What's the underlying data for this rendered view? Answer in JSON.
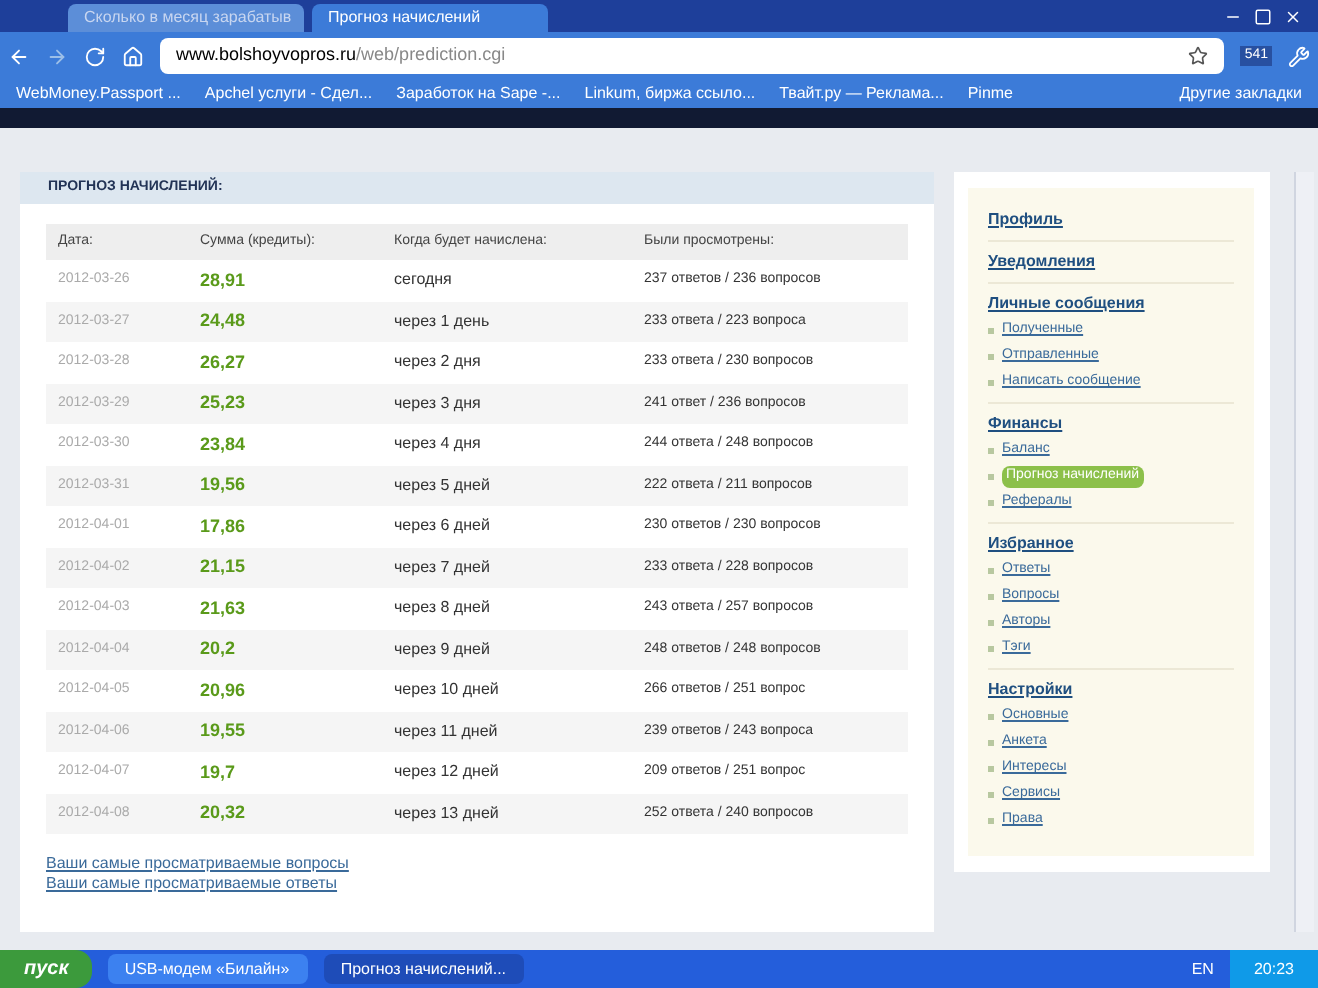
{
  "browser": {
    "tabs": [
      {
        "label": "Сколько в месяц зарабатыв",
        "selected": false
      },
      {
        "label": "Прогноз начислений",
        "selected": true
      }
    ],
    "address": {
      "domain": "www.bolshoyvopros.ru",
      "path": "/web/prediction.cgi"
    },
    "bookmarks": [
      "WebMoney.Passport ...",
      "Apchel услуги - Сдел...",
      "Заработок на Sape -...",
      "Linkum, биржа ссыло...",
      "Твайт.ру — Реклама...",
      "Pinme"
    ],
    "other_bookmarks": "Другие закладки",
    "badge": "541"
  },
  "panel": {
    "title": "ПРОГНОЗ НАЧИСЛЕНИЙ:",
    "columns": [
      "Дата:",
      "Сумма (кредиты):",
      "Когда будет начислена:",
      "Были просмотрены:"
    ],
    "rows": [
      [
        "2012-03-26",
        "28,91",
        "сегодня",
        "237 ответов / 236 вопросов"
      ],
      [
        "2012-03-27",
        "24,48",
        "через 1 день",
        "233 ответа / 223 вопроса"
      ],
      [
        "2012-03-28",
        "26,27",
        "через 2 дня",
        "233 ответа / 230 вопросов"
      ],
      [
        "2012-03-29",
        "25,23",
        "через 3 дня",
        "241 ответ / 236 вопросов"
      ],
      [
        "2012-03-30",
        "23,84",
        "через 4 дня",
        "244 ответа / 248 вопросов"
      ],
      [
        "2012-03-31",
        "19,56",
        "через 5 дней",
        "222 ответа / 211 вопросов"
      ],
      [
        "2012-04-01",
        "17,86",
        "через 6 дней",
        "230 ответов / 230 вопросов"
      ],
      [
        "2012-04-02",
        "21,15",
        "через 7 дней",
        "233 ответа / 228 вопросов"
      ],
      [
        "2012-04-03",
        "21,63",
        "через 8 дней",
        "243 ответа / 257 вопросов"
      ],
      [
        "2012-04-04",
        "20,2",
        "через 9 дней",
        "248 ответов / 248 вопросов"
      ],
      [
        "2012-04-05",
        "20,96",
        "через 10 дней",
        "266 ответов / 251 вопрос"
      ],
      [
        "2012-04-06",
        "19,55",
        "через 11 дней",
        "239 ответов / 243 вопроса"
      ],
      [
        "2012-04-07",
        "19,7",
        "через 12 дней",
        "209 ответов / 251 вопрос"
      ],
      [
        "2012-04-08",
        "20,32",
        "через 13 дней",
        "252 ответа / 240 вопросов"
      ]
    ],
    "links": [
      "Ваши самые просматриваемые вопросы",
      "Ваши самые просматриваемые ответы"
    ]
  },
  "sidebar": [
    {
      "heading": "Профиль"
    },
    {
      "heading": "Уведомления"
    },
    {
      "heading": "Личные сообщения",
      "items": [
        {
          "label": "Полученные",
          "selected": false
        },
        {
          "label": "Отправленные",
          "selected": false
        },
        {
          "label": "Написать сообщение",
          "selected": false
        }
      ]
    },
    {
      "heading": "Финансы",
      "items": [
        {
          "label": "Баланс",
          "selected": false
        },
        {
          "label": "Прогноз начислений",
          "selected": true
        },
        {
          "label": "Рефералы",
          "selected": false
        }
      ]
    },
    {
      "heading": "Избранное",
      "items": [
        {
          "label": "Ответы",
          "selected": false
        },
        {
          "label": "Вопросы",
          "selected": false
        },
        {
          "label": "Авторы",
          "selected": false
        },
        {
          "label": "Тэги",
          "selected": false
        }
      ]
    },
    {
      "heading": "Настройки",
      "items": [
        {
          "label": "Основные",
          "selected": false
        },
        {
          "label": "Анкета",
          "selected": false
        },
        {
          "label": "Интересы",
          "selected": false
        },
        {
          "label": "Сервисы",
          "selected": false
        },
        {
          "label": "Права",
          "selected": false
        }
      ]
    }
  ],
  "taskbar": {
    "start": "пуск",
    "windows": [
      {
        "label": "USB-модем «Билайн»",
        "selected": false
      },
      {
        "label": "Прогноз начислений...",
        "selected": true
      }
    ],
    "lang": "EN",
    "time": "20:23"
  }
}
